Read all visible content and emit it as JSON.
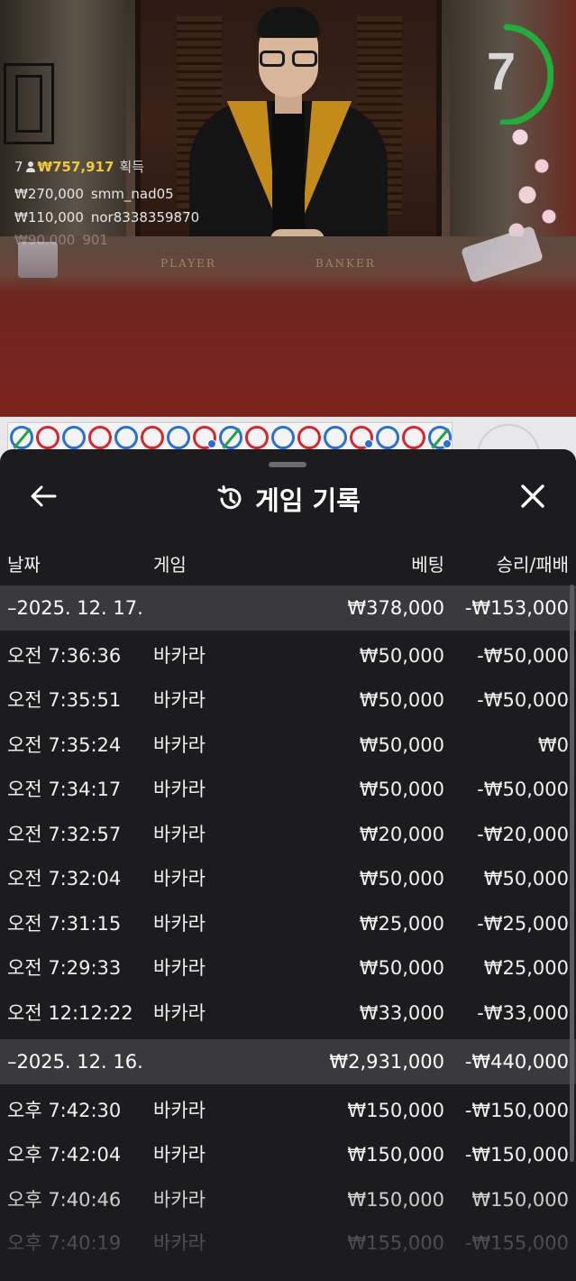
{
  "video": {
    "timer": "7",
    "felt_player": "PLAYER",
    "felt_banker": "BANKER",
    "win_count": "7",
    "win_amount": "₩757,917",
    "win_label": "획득",
    "bets": [
      {
        "amount": "₩270,000",
        "user": "smm_nad05"
      },
      {
        "amount": "₩110,000",
        "user": "nor8338359870"
      },
      {
        "amount": "₩90,000",
        "user": "901"
      }
    ]
  },
  "bead_road": [
    "tie",
    "red",
    "blue",
    "red",
    "blue",
    "red",
    "blue",
    "red-pair",
    "tie",
    "red",
    "blue",
    "red",
    "blue",
    "red-pair",
    "blue",
    "red",
    "tie-pair"
  ],
  "history": {
    "title": "게임 기록",
    "columns": {
      "date": "날짜",
      "game": "게임",
      "bet": "베팅",
      "result": "승리/패배"
    },
    "groups": [
      {
        "date": "–2025. 12. 17.",
        "bet": "₩378,000",
        "result": "-₩153,000",
        "rows": [
          {
            "time": "오전 7:36:36",
            "game": "바카라",
            "bet": "₩50,000",
            "result": "-₩50,000"
          },
          {
            "time": "오전 7:35:51",
            "game": "바카라",
            "bet": "₩50,000",
            "result": "-₩50,000"
          },
          {
            "time": "오전 7:35:24",
            "game": "바카라",
            "bet": "₩50,000",
            "result": "₩0"
          },
          {
            "time": "오전 7:34:17",
            "game": "바카라",
            "bet": "₩50,000",
            "result": "-₩50,000"
          },
          {
            "time": "오전 7:32:57",
            "game": "바카라",
            "bet": "₩20,000",
            "result": "-₩20,000"
          },
          {
            "time": "오전 7:32:04",
            "game": "바카라",
            "bet": "₩50,000",
            "result": "₩50,000"
          },
          {
            "time": "오전 7:31:15",
            "game": "바카라",
            "bet": "₩25,000",
            "result": "-₩25,000"
          },
          {
            "time": "오전 7:29:33",
            "game": "바카라",
            "bet": "₩50,000",
            "result": "₩25,000"
          },
          {
            "time": "오전 12:12:22",
            "game": "바카라",
            "bet": "₩33,000",
            "result": "-₩33,000"
          }
        ]
      },
      {
        "date": "–2025. 12. 16.",
        "bet": "₩2,931,000",
        "result": "-₩440,000",
        "rows": [
          {
            "time": "오후 7:42:30",
            "game": "바카라",
            "bet": "₩150,000",
            "result": "-₩150,000"
          },
          {
            "time": "오후 7:42:04",
            "game": "바카라",
            "bet": "₩150,000",
            "result": "-₩150,000"
          },
          {
            "time": "오후 7:40:46",
            "game": "바카라",
            "bet": "₩150,000",
            "result": "₩150,000"
          },
          {
            "time": "오후 7:40:19",
            "game": "바카라",
            "bet": "₩155,000",
            "result": "-₩155,000"
          }
        ]
      }
    ]
  }
}
